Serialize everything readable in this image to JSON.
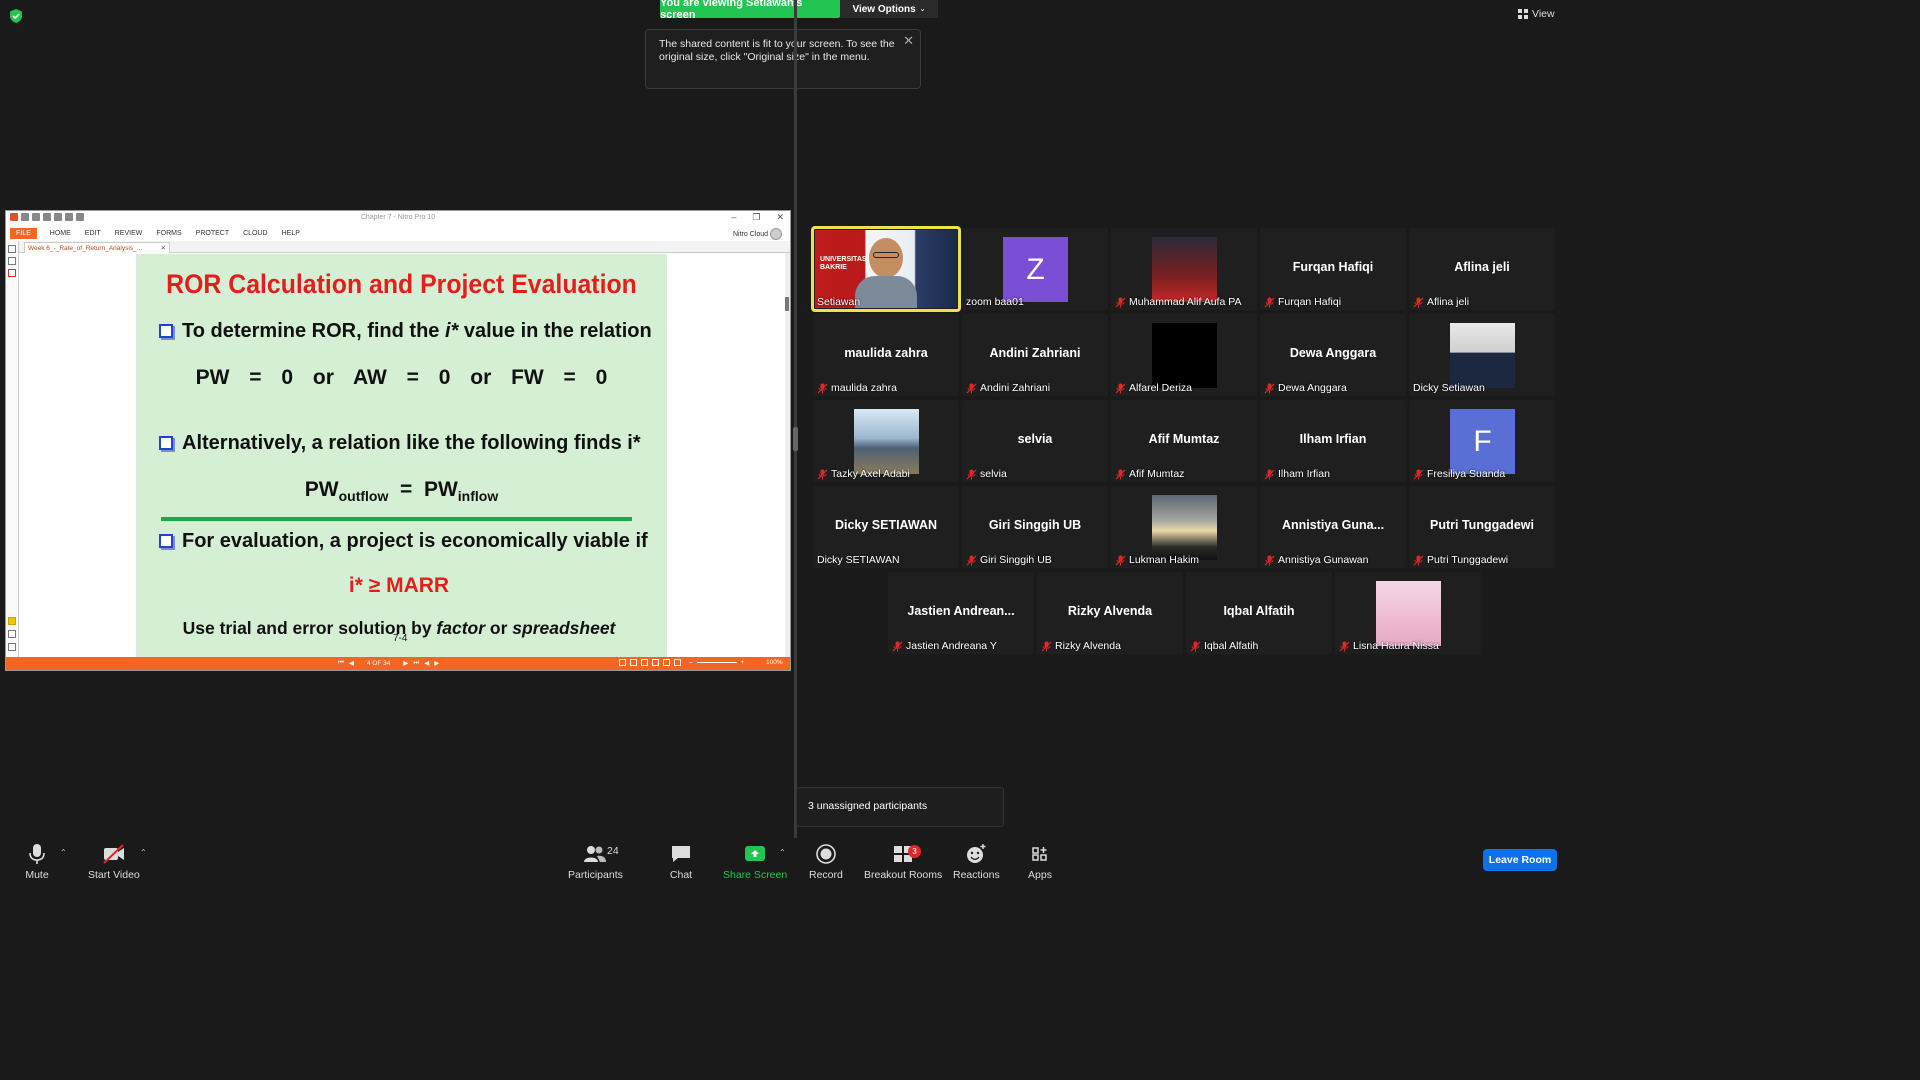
{
  "meeting": {
    "banner": "You are viewing Setiawan's screen",
    "view_options": "View Options",
    "tooltip": "The shared content is fit to your screen. To see the original size, click \"Original size\" in the menu.",
    "view_button": "View",
    "unassigned": "3 unassigned participants"
  },
  "nitro": {
    "window_title": "Chapter 7 - Nitro Pro 10",
    "menus": [
      "FILE",
      "HOME",
      "EDIT",
      "REVIEW",
      "FORMS",
      "PROTECT",
      "CLOUD",
      "HELP"
    ],
    "cloud_label": "Nitro Cloud",
    "tab_label": "Week 6_-_Rate_of_Return_Analysis_...",
    "page_indicator": "4 OF 34",
    "zoom": "100%",
    "accent": "#f26522"
  },
  "slide": {
    "title": "ROR Calculation and Project Evaluation",
    "b1_pre": "To determine ROR, find the ",
    "b1_var": "i*",
    "b1_post": " value in the relation",
    "eq1": "PW = 0   or   AW = 0   or   FW = 0",
    "b2": "Alternatively, a relation like the following finds i*",
    "eq2_a": "PW",
    "eq2_a_sub": "outflow",
    "eq2_eq": "  =  ",
    "eq2_b": "PW",
    "eq2_b_sub": "inflow",
    "b3": "For evaluation, a project is economically viable if",
    "eq3": "i* ≥ MARR",
    "foot_pre": "Use trial and error solution by ",
    "foot_f": "factor",
    "foot_mid": " or ",
    "foot_s": "spreadsheet",
    "page_num": "7-4"
  },
  "participants": [
    {
      "name": "Setiawan",
      "type": "video",
      "muted": false,
      "active": true
    },
    {
      "name": "zoom baa01",
      "type": "avatar",
      "letter": "Z",
      "color": "#7a4fd6",
      "muted": false
    },
    {
      "name": "Muhammad Alif Aufa PA",
      "type": "photo",
      "muted": true
    },
    {
      "name": "Furqan Hafiqi",
      "big": "Furqan Hafiqi",
      "type": "text",
      "muted": true
    },
    {
      "name": "Aflina jeli",
      "big": "Aflina jeli",
      "type": "text",
      "muted": true
    },
    {
      "name": "maulida zahra",
      "big": "maulida zahra",
      "type": "text",
      "muted": true
    },
    {
      "name": "Andini Zahriani",
      "big": "Andini Zahriani",
      "type": "text",
      "muted": true
    },
    {
      "name": "Alfarel Deriza",
      "type": "black",
      "muted": true
    },
    {
      "name": "Dewa Anggara",
      "big": "Dewa Anggara",
      "type": "text",
      "muted": true
    },
    {
      "name": "Dicky Setiawan",
      "type": "photo",
      "muted": false
    },
    {
      "name": "Tazky Axel Adabi",
      "type": "photo",
      "muted": true
    },
    {
      "name": "selvia",
      "big": "selvia",
      "type": "text",
      "muted": true
    },
    {
      "name": "Afif Mumtaz",
      "big": "Afif Mumtaz",
      "type": "text",
      "muted": true
    },
    {
      "name": "Ilham Irfian",
      "big": "Ilham Irfian",
      "type": "text",
      "muted": true
    },
    {
      "name": "Fresiliya Suanda",
      "type": "avatar",
      "letter": "F",
      "color": "#5a6fd6",
      "muted": true
    },
    {
      "name": "Dicky SETIAWAN",
      "big": "Dicky SETIAWAN",
      "type": "text",
      "muted": false
    },
    {
      "name": "Giri Singgih UB",
      "big": "Giri Singgih UB",
      "type": "text",
      "muted": true
    },
    {
      "name": "Lukman Hakim",
      "type": "photo",
      "muted": true
    },
    {
      "name": "Annistiya Gunawan",
      "big": "Annistiya Guna...",
      "type": "text",
      "muted": true
    },
    {
      "name": "Putri Tunggadewi",
      "big": "Putri Tunggadewi",
      "type": "text",
      "muted": true
    },
    {
      "name": "Jastien Andreana Y",
      "big": "Jastien Andrean...",
      "type": "text",
      "muted": true
    },
    {
      "name": "Rizky Alvenda",
      "big": "Rizky Alvenda",
      "type": "text",
      "muted": true
    },
    {
      "name": "Iqbal Alfatih",
      "big": "Iqbal Alfatih",
      "type": "text",
      "muted": true
    },
    {
      "name": "Lisna Haura Nissa",
      "type": "photo",
      "muted": true
    }
  ],
  "toolbar": {
    "mute": "Mute",
    "start_video": "Start Video",
    "participants": "Participants",
    "participant_count": "24",
    "chat": "Chat",
    "share_screen": "Share Screen",
    "record": "Record",
    "breakout": "Breakout Rooms",
    "breakout_badge": "3",
    "reactions": "Reactions",
    "apps": "Apps",
    "leave": "Leave Room"
  },
  "colors": {
    "banner_green": "#23c552",
    "active_speaker": "#f0e04b",
    "leave_blue": "#0e71eb",
    "slide_title_red": "#e41d1d",
    "slide_bg": "#d5efd5"
  }
}
